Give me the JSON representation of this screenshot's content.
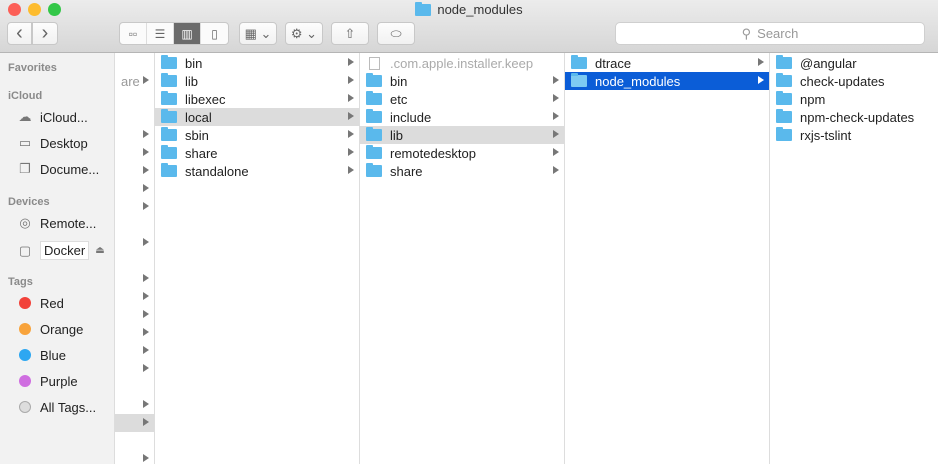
{
  "window": {
    "title": "node_modules",
    "colors": {
      "close": "#fc5f57",
      "minimize": "#fdbc2e",
      "zoom": "#33c748",
      "selection": "#0b5dd7",
      "folder": "#5ab9ec"
    }
  },
  "toolbar": {
    "back": "‹",
    "forward": "›",
    "search_placeholder": "Search"
  },
  "sidebar": {
    "favorites_header": "Favorites",
    "icloud_header": "iCloud",
    "icloud_items": [
      {
        "label": "iCloud...",
        "icon": "cloud-icon"
      },
      {
        "label": "Desktop",
        "icon": "desktop-icon"
      },
      {
        "label": "Docume...",
        "icon": "documents-icon"
      }
    ],
    "devices_header": "Devices",
    "devices": [
      {
        "label": "Remote...",
        "icon": "disc-icon"
      },
      {
        "label": "Docker",
        "icon": "drive-icon"
      }
    ],
    "tags_header": "Tags",
    "tags": [
      {
        "label": "Red",
        "color": "#f2423a"
      },
      {
        "label": "Orange",
        "color": "#f8a33b"
      },
      {
        "label": "Blue",
        "color": "#2da7f1"
      },
      {
        "label": "Purple",
        "color": "#cf6ee0"
      },
      {
        "label": "All Tags...",
        "color": "#dddddd"
      }
    ]
  },
  "columns": [
    {
      "items": [
        {
          "name": "are",
          "arrow": true
        },
        {
          "name": "",
          "arrow": false
        },
        {
          "name": "",
          "arrow": false
        },
        {
          "name": "",
          "arrow": true
        },
        {
          "name": "",
          "arrow": true
        },
        {
          "name": "",
          "arrow": true
        },
        {
          "name": "",
          "arrow": true
        },
        {
          "name": "",
          "arrow": true
        },
        {
          "name": "",
          "arrow": false
        },
        {
          "name": "",
          "arrow": true
        },
        {
          "name": "",
          "arrow": false
        },
        {
          "name": "",
          "arrow": true
        },
        {
          "name": "",
          "arrow": true
        },
        {
          "name": "",
          "arrow": true
        },
        {
          "name": "",
          "arrow": true
        },
        {
          "name": "",
          "arrow": true
        },
        {
          "name": "",
          "arrow": true
        },
        {
          "name": "",
          "arrow": false
        },
        {
          "name": "",
          "arrow": true
        },
        {
          "name": "",
          "arrow": true,
          "selected": true
        },
        {
          "name": "",
          "arrow": false
        },
        {
          "name": "",
          "arrow": true
        }
      ],
      "start": 1,
      "noicon": true
    },
    {
      "items": [
        {
          "name": "bin",
          "arrow": true
        },
        {
          "name": "lib",
          "arrow": true
        },
        {
          "name": "libexec",
          "arrow": true
        },
        {
          "name": "local",
          "arrow": true,
          "selected": true
        },
        {
          "name": "sbin",
          "arrow": true
        },
        {
          "name": "share",
          "arrow": true
        },
        {
          "name": "standalone",
          "arrow": true
        }
      ]
    },
    {
      "items": [
        {
          "name": ".com.apple.installer.keep",
          "arrow": false,
          "file": true
        },
        {
          "name": "bin",
          "arrow": true
        },
        {
          "name": "etc",
          "arrow": true
        },
        {
          "name": "include",
          "arrow": true
        },
        {
          "name": "lib",
          "arrow": true,
          "selected": true
        },
        {
          "name": "remotedesktop",
          "arrow": true
        },
        {
          "name": "share",
          "arrow": true
        }
      ]
    },
    {
      "items": [
        {
          "name": "dtrace",
          "arrow": true
        },
        {
          "name": "node_modules",
          "arrow": true,
          "active": true
        }
      ]
    },
    {
      "items": [
        {
          "name": "@angular",
          "arrow": false
        },
        {
          "name": "check-updates",
          "arrow": false
        },
        {
          "name": "npm",
          "arrow": false
        },
        {
          "name": "npm-check-updates",
          "arrow": false
        },
        {
          "name": "rxjs-tslint",
          "arrow": false
        }
      ]
    }
  ]
}
